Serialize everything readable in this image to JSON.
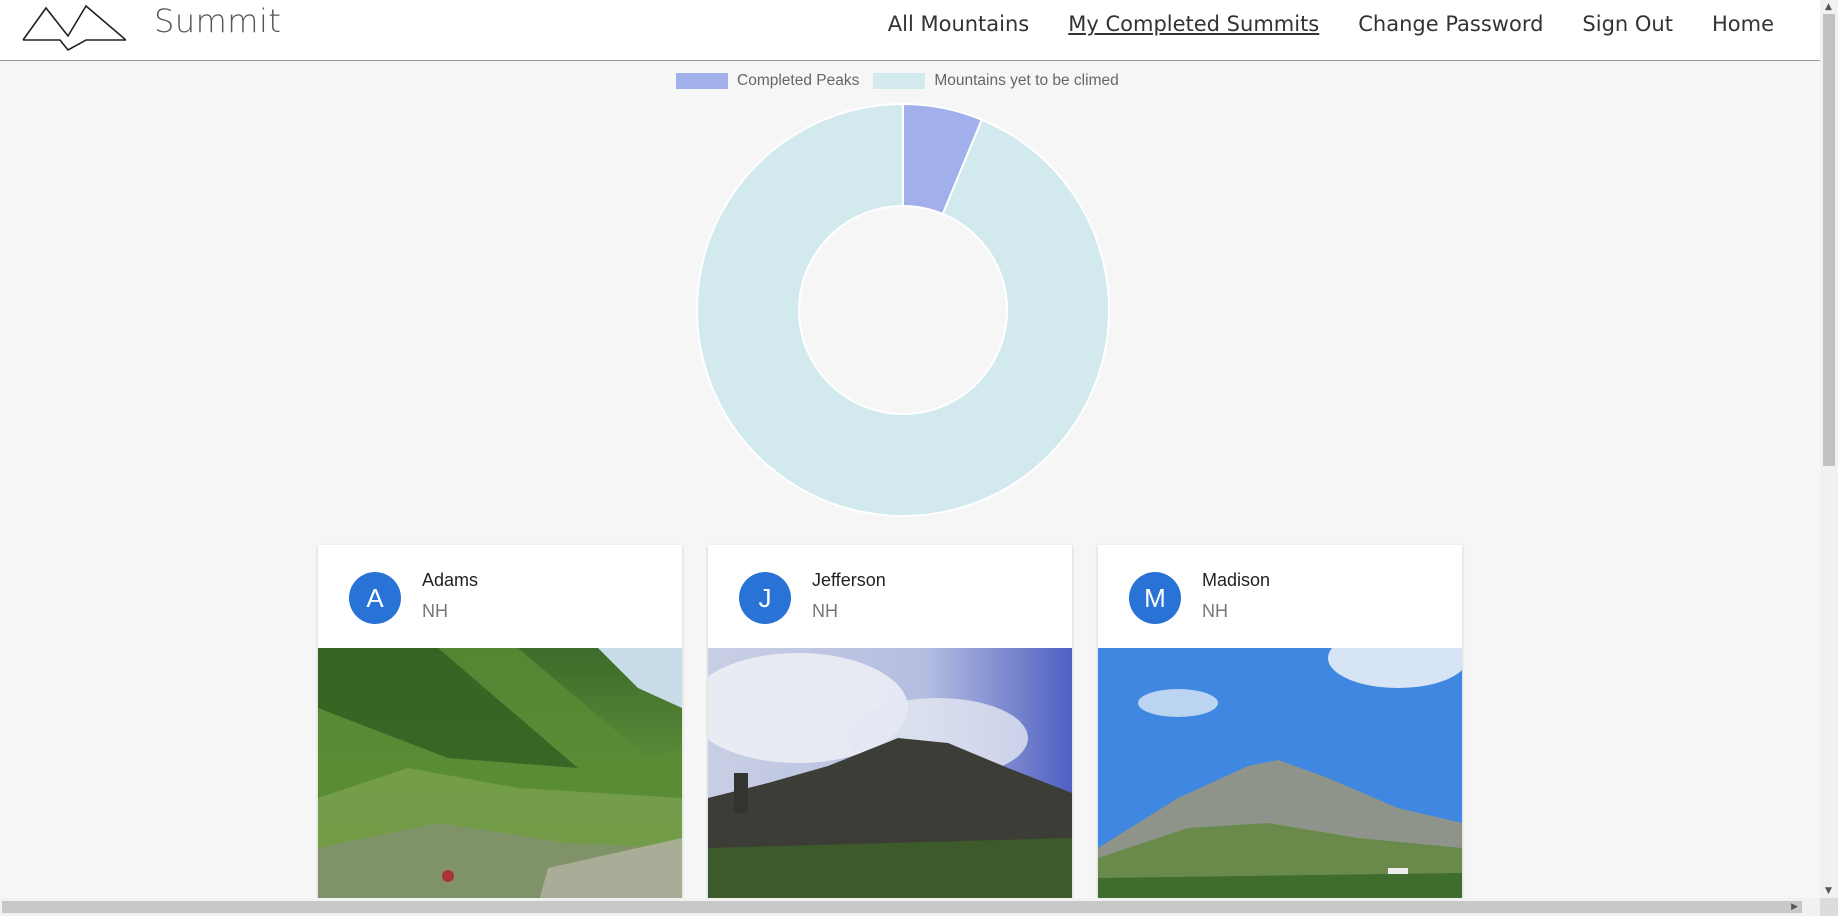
{
  "brand": {
    "name": "Summit",
    "logo_icon": "mountain-logo-icon"
  },
  "nav": {
    "links": [
      {
        "label": "All Mountains",
        "active": false
      },
      {
        "label": "My Completed Summits",
        "active": true
      },
      {
        "label": "Change Password",
        "active": false
      },
      {
        "label": "Sign Out",
        "active": false
      },
      {
        "label": "Home",
        "active": false
      }
    ]
  },
  "chart_data": {
    "type": "pie",
    "variant": "doughnut",
    "categories": [
      "Completed Peaks",
      "Mountains yet to be climed"
    ],
    "values": [
      3,
      45
    ],
    "colors": [
      "#a1afeb",
      "#d2e9ee"
    ],
    "legend_position": "top"
  },
  "cards": [
    {
      "initial": "A",
      "title": "Adams",
      "subtitle": "NH",
      "avatar_color": "#2a73d6",
      "image": "mountain-photo-adams"
    },
    {
      "initial": "J",
      "title": "Jefferson",
      "subtitle": "NH",
      "avatar_color": "#2a73d6",
      "image": "mountain-photo-jefferson"
    },
    {
      "initial": "M",
      "title": "Madison",
      "subtitle": "NH",
      "avatar_color": "#2a73d6",
      "image": "mountain-photo-madison"
    }
  ],
  "colors": {
    "navbar_bg": "#ffffff",
    "page_bg": "#f6f6f6",
    "avatar": "#2a73d6"
  }
}
